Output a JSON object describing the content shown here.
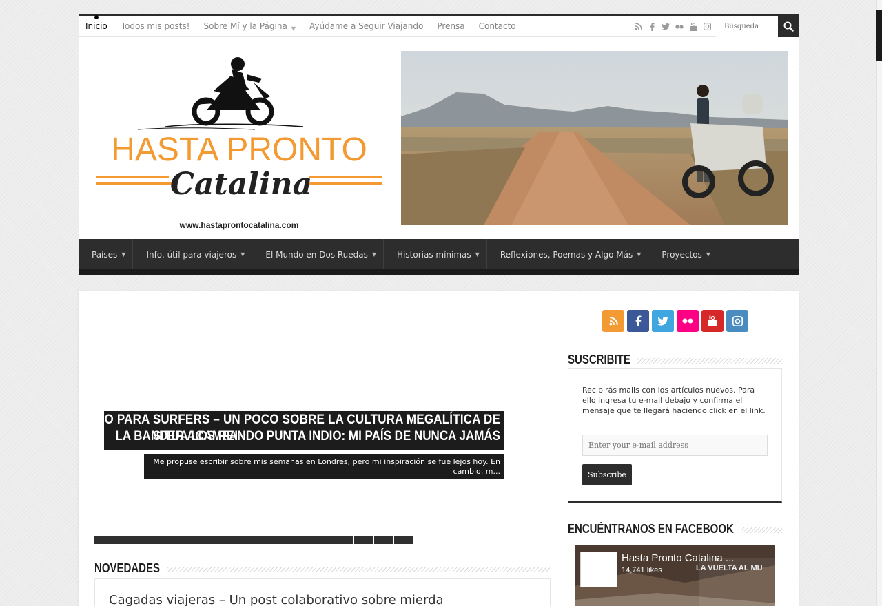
{
  "top_nav": {
    "items": [
      {
        "label": "Inicio",
        "active": true
      },
      {
        "label": "Todos mis posts!"
      },
      {
        "label": "Sobre Mí y la Página",
        "has_dropdown": true
      },
      {
        "label": "Ayúdame a Seguir Viajando"
      },
      {
        "label": "Prensa"
      },
      {
        "label": "Contacto"
      }
    ],
    "social_icons": [
      "rss-icon",
      "facebook-icon",
      "twitter-icon",
      "flickr-icon",
      "youtube-icon",
      "instagram-icon"
    ],
    "search_placeholder": "Búsqueda"
  },
  "header": {
    "logo_title": "HASTA PRONTO",
    "logo_script": "Catalina",
    "logo_url": "www.hastaprontocatalina.com"
  },
  "main_nav": {
    "items": [
      {
        "label": "Países"
      },
      {
        "label": "Info. útil para viajeros"
      },
      {
        "label": "El Mundo en Dos Ruedas"
      },
      {
        "label": "Historias mínimas"
      },
      {
        "label": "Reflexiones, Poemas y Algo Más"
      },
      {
        "label": "Proyectos"
      }
    ]
  },
  "slider": {
    "title_line1": "PULAU NIAS NO ES SÓLO PARA SURFERS – UN POCO SOBRE LA CULTURA MEGALÍTICA DE",
    "title_line2a": "SITUA LOS REI",
    "title_line2b": "LA BANDER ACAMPANDO PUNTA INDIO: MI PAÍS DE NUNCA JAMÁS",
    "excerpt": "Me propuse escribir sobre mis semanas en Londres, pero mi inspiración se fue lejos hoy. En cambio, m...",
    "page_count": 16
  },
  "novedades": {
    "heading": "NOVEDADES",
    "first_title": "Cagadas viajeras – Un post colaborativo sobre mierda"
  },
  "sidebar": {
    "social_buttons": [
      {
        "icon": "rss-icon",
        "color": "#f39a32"
      },
      {
        "icon": "facebook-icon",
        "color": "#3b5998"
      },
      {
        "icon": "twitter-icon",
        "color": "#40a6e0"
      },
      {
        "icon": "flickr-icon",
        "color": "#ff0084"
      },
      {
        "icon": "youtube-icon",
        "color": "#d62828"
      },
      {
        "icon": "instagram-icon",
        "color": "#4a8bc0"
      }
    ],
    "subscribe": {
      "heading": "SUSCRIBITE",
      "text": "Recibirás mails con los artículos nuevos. Para ello ingresa tu e-mail debajo y confirma el mensaje que te llegará haciendo click en el link.",
      "email_placeholder": "Enter your e-mail address",
      "button_label": "Subscribe"
    },
    "facebook": {
      "heading": "ENCUÉNTRANOS EN FACEBOOK",
      "page_name": "Hasta Pronto Catalina ...",
      "likes": "14,741 likes",
      "overlay_text": "LA VUELTA AL MU"
    }
  }
}
